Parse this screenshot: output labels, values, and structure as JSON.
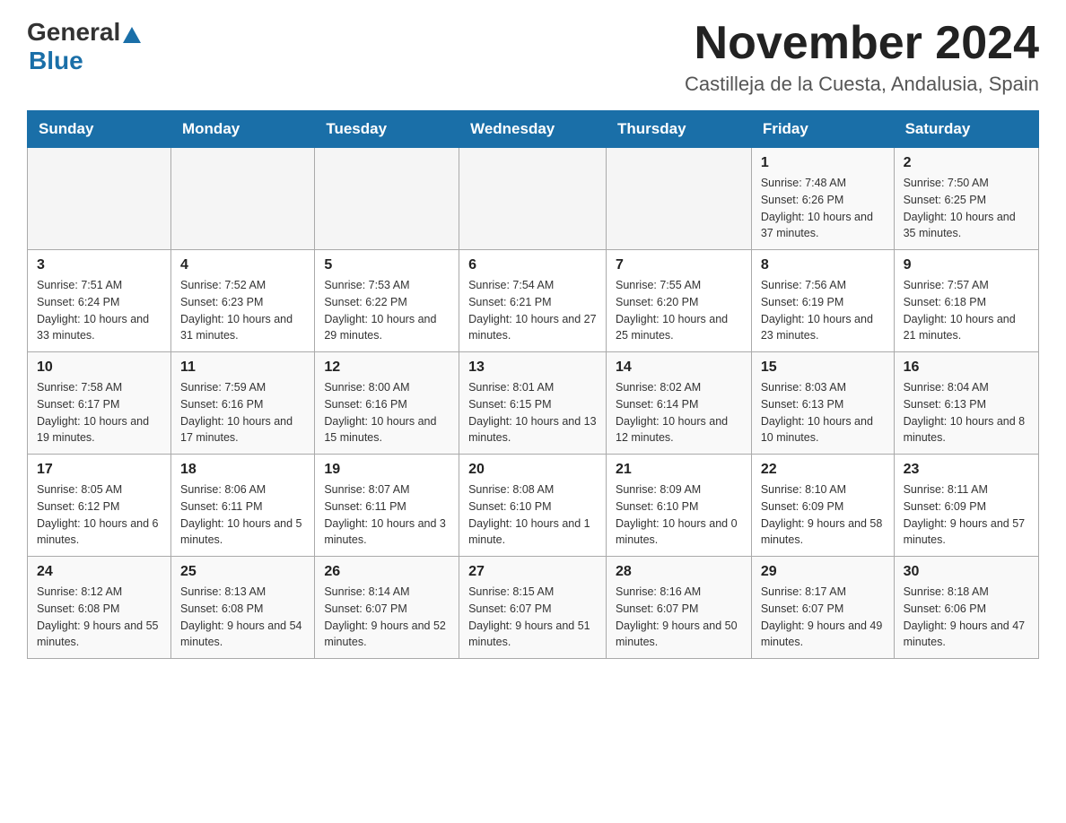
{
  "header": {
    "logo": {
      "general": "General",
      "arrow": "▶",
      "blue": "Blue"
    },
    "title": "November 2024",
    "location": "Castilleja de la Cuesta, Andalusia, Spain"
  },
  "calendar": {
    "days_of_week": [
      "Sunday",
      "Monday",
      "Tuesday",
      "Wednesday",
      "Thursday",
      "Friday",
      "Saturday"
    ],
    "weeks": [
      [
        {
          "day": "",
          "info": ""
        },
        {
          "day": "",
          "info": ""
        },
        {
          "day": "",
          "info": ""
        },
        {
          "day": "",
          "info": ""
        },
        {
          "day": "",
          "info": ""
        },
        {
          "day": "1",
          "info": "Sunrise: 7:48 AM\nSunset: 6:26 PM\nDaylight: 10 hours and 37 minutes."
        },
        {
          "day": "2",
          "info": "Sunrise: 7:50 AM\nSunset: 6:25 PM\nDaylight: 10 hours and 35 minutes."
        }
      ],
      [
        {
          "day": "3",
          "info": "Sunrise: 7:51 AM\nSunset: 6:24 PM\nDaylight: 10 hours and 33 minutes."
        },
        {
          "day": "4",
          "info": "Sunrise: 7:52 AM\nSunset: 6:23 PM\nDaylight: 10 hours and 31 minutes."
        },
        {
          "day": "5",
          "info": "Sunrise: 7:53 AM\nSunset: 6:22 PM\nDaylight: 10 hours and 29 minutes."
        },
        {
          "day": "6",
          "info": "Sunrise: 7:54 AM\nSunset: 6:21 PM\nDaylight: 10 hours and 27 minutes."
        },
        {
          "day": "7",
          "info": "Sunrise: 7:55 AM\nSunset: 6:20 PM\nDaylight: 10 hours and 25 minutes."
        },
        {
          "day": "8",
          "info": "Sunrise: 7:56 AM\nSunset: 6:19 PM\nDaylight: 10 hours and 23 minutes."
        },
        {
          "day": "9",
          "info": "Sunrise: 7:57 AM\nSunset: 6:18 PM\nDaylight: 10 hours and 21 minutes."
        }
      ],
      [
        {
          "day": "10",
          "info": "Sunrise: 7:58 AM\nSunset: 6:17 PM\nDaylight: 10 hours and 19 minutes."
        },
        {
          "day": "11",
          "info": "Sunrise: 7:59 AM\nSunset: 6:16 PM\nDaylight: 10 hours and 17 minutes."
        },
        {
          "day": "12",
          "info": "Sunrise: 8:00 AM\nSunset: 6:16 PM\nDaylight: 10 hours and 15 minutes."
        },
        {
          "day": "13",
          "info": "Sunrise: 8:01 AM\nSunset: 6:15 PM\nDaylight: 10 hours and 13 minutes."
        },
        {
          "day": "14",
          "info": "Sunrise: 8:02 AM\nSunset: 6:14 PM\nDaylight: 10 hours and 12 minutes."
        },
        {
          "day": "15",
          "info": "Sunrise: 8:03 AM\nSunset: 6:13 PM\nDaylight: 10 hours and 10 minutes."
        },
        {
          "day": "16",
          "info": "Sunrise: 8:04 AM\nSunset: 6:13 PM\nDaylight: 10 hours and 8 minutes."
        }
      ],
      [
        {
          "day": "17",
          "info": "Sunrise: 8:05 AM\nSunset: 6:12 PM\nDaylight: 10 hours and 6 minutes."
        },
        {
          "day": "18",
          "info": "Sunrise: 8:06 AM\nSunset: 6:11 PM\nDaylight: 10 hours and 5 minutes."
        },
        {
          "day": "19",
          "info": "Sunrise: 8:07 AM\nSunset: 6:11 PM\nDaylight: 10 hours and 3 minutes."
        },
        {
          "day": "20",
          "info": "Sunrise: 8:08 AM\nSunset: 6:10 PM\nDaylight: 10 hours and 1 minute."
        },
        {
          "day": "21",
          "info": "Sunrise: 8:09 AM\nSunset: 6:10 PM\nDaylight: 10 hours and 0 minutes."
        },
        {
          "day": "22",
          "info": "Sunrise: 8:10 AM\nSunset: 6:09 PM\nDaylight: 9 hours and 58 minutes."
        },
        {
          "day": "23",
          "info": "Sunrise: 8:11 AM\nSunset: 6:09 PM\nDaylight: 9 hours and 57 minutes."
        }
      ],
      [
        {
          "day": "24",
          "info": "Sunrise: 8:12 AM\nSunset: 6:08 PM\nDaylight: 9 hours and 55 minutes."
        },
        {
          "day": "25",
          "info": "Sunrise: 8:13 AM\nSunset: 6:08 PM\nDaylight: 9 hours and 54 minutes."
        },
        {
          "day": "26",
          "info": "Sunrise: 8:14 AM\nSunset: 6:07 PM\nDaylight: 9 hours and 52 minutes."
        },
        {
          "day": "27",
          "info": "Sunrise: 8:15 AM\nSunset: 6:07 PM\nDaylight: 9 hours and 51 minutes."
        },
        {
          "day": "28",
          "info": "Sunrise: 8:16 AM\nSunset: 6:07 PM\nDaylight: 9 hours and 50 minutes."
        },
        {
          "day": "29",
          "info": "Sunrise: 8:17 AM\nSunset: 6:07 PM\nDaylight: 9 hours and 49 minutes."
        },
        {
          "day": "30",
          "info": "Sunrise: 8:18 AM\nSunset: 6:06 PM\nDaylight: 9 hours and 47 minutes."
        }
      ]
    ]
  }
}
